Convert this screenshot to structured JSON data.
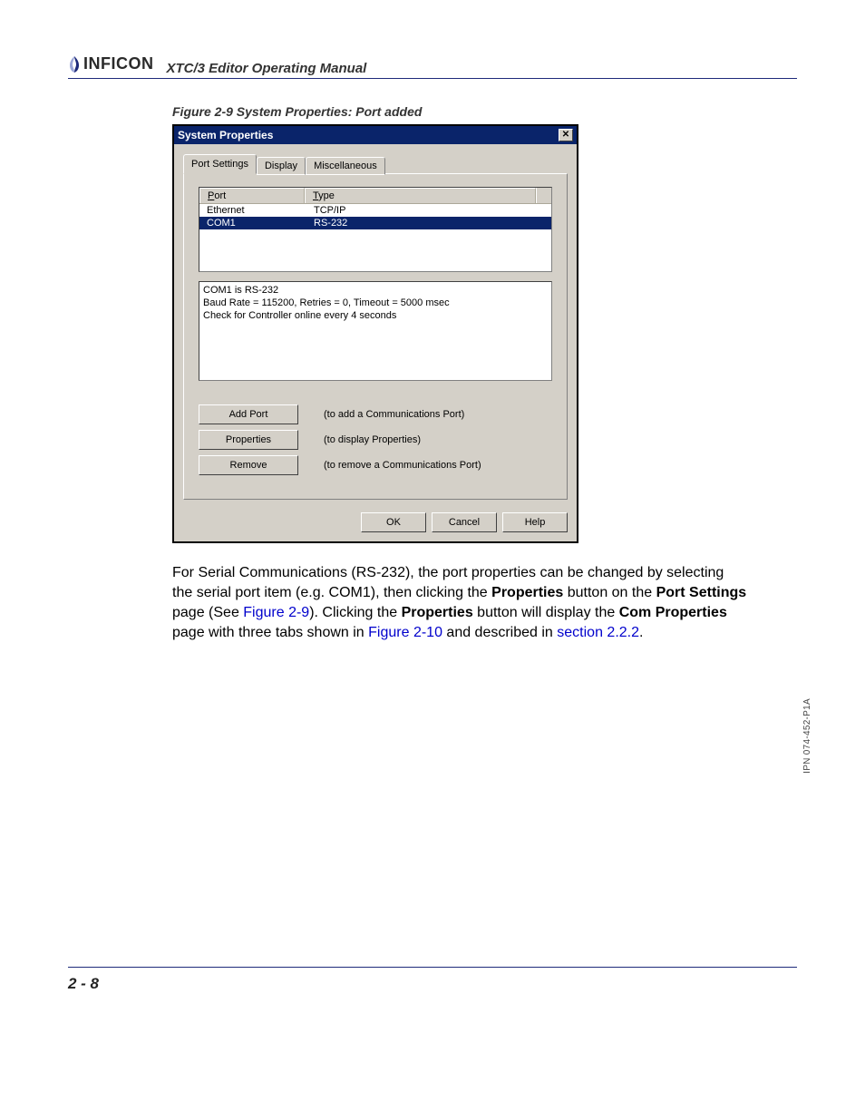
{
  "header": {
    "brand": "INFICON",
    "doc_title": "XTC/3 Editor Operating Manual"
  },
  "figure_caption": "Figure 2-9  System Properties: Port added",
  "dialog": {
    "title": "System Properties",
    "tabs": [
      "Port Settings",
      "Display",
      "Miscellaneous"
    ],
    "list": {
      "headers": {
        "port": "Port",
        "type": "Type"
      },
      "rows": [
        {
          "port": "Ethernet",
          "type": "TCP/IP",
          "selected": false
        },
        {
          "port": "COM1",
          "type": "RS-232",
          "selected": true
        }
      ]
    },
    "info": {
      "line1": "COM1 is RS-232",
      "line2": "Baud Rate = 115200, Retries = 0, Timeout = 5000 msec",
      "line3": "Check for Controller online every 4 seconds"
    },
    "actions": [
      {
        "key": "add",
        "label": "Add Port",
        "desc": "(to add a Communications Port)"
      },
      {
        "key": "props",
        "label": "Properties",
        "desc": "(to display Properties)"
      },
      {
        "key": "remove",
        "label": "Remove",
        "desc": "(to remove a Communications Port)"
      }
    ],
    "footer": {
      "ok": "OK",
      "cancel": "Cancel",
      "help": "Help"
    }
  },
  "paragraph": {
    "t1": "For Serial Communications (RS-232), the port properties can be changed by selecting the serial port item (e.g. COM1), then clicking the ",
    "b1": "Properties",
    "t2": " button on the ",
    "b2": "Port Settings",
    "t3": " page (See ",
    "l1": "Figure 2-9",
    "t4": "). Clicking the ",
    "b3": "Properties",
    "t5": " button will display the ",
    "b4": "Com Properties",
    "t6": " page with three tabs shown in ",
    "l2": "Figure 2-10",
    "t7": " and described in ",
    "l3": "section 2.2.2",
    "t8": "."
  },
  "side_note": "IPN 074-452-P1A",
  "page_number": "2 - 8"
}
